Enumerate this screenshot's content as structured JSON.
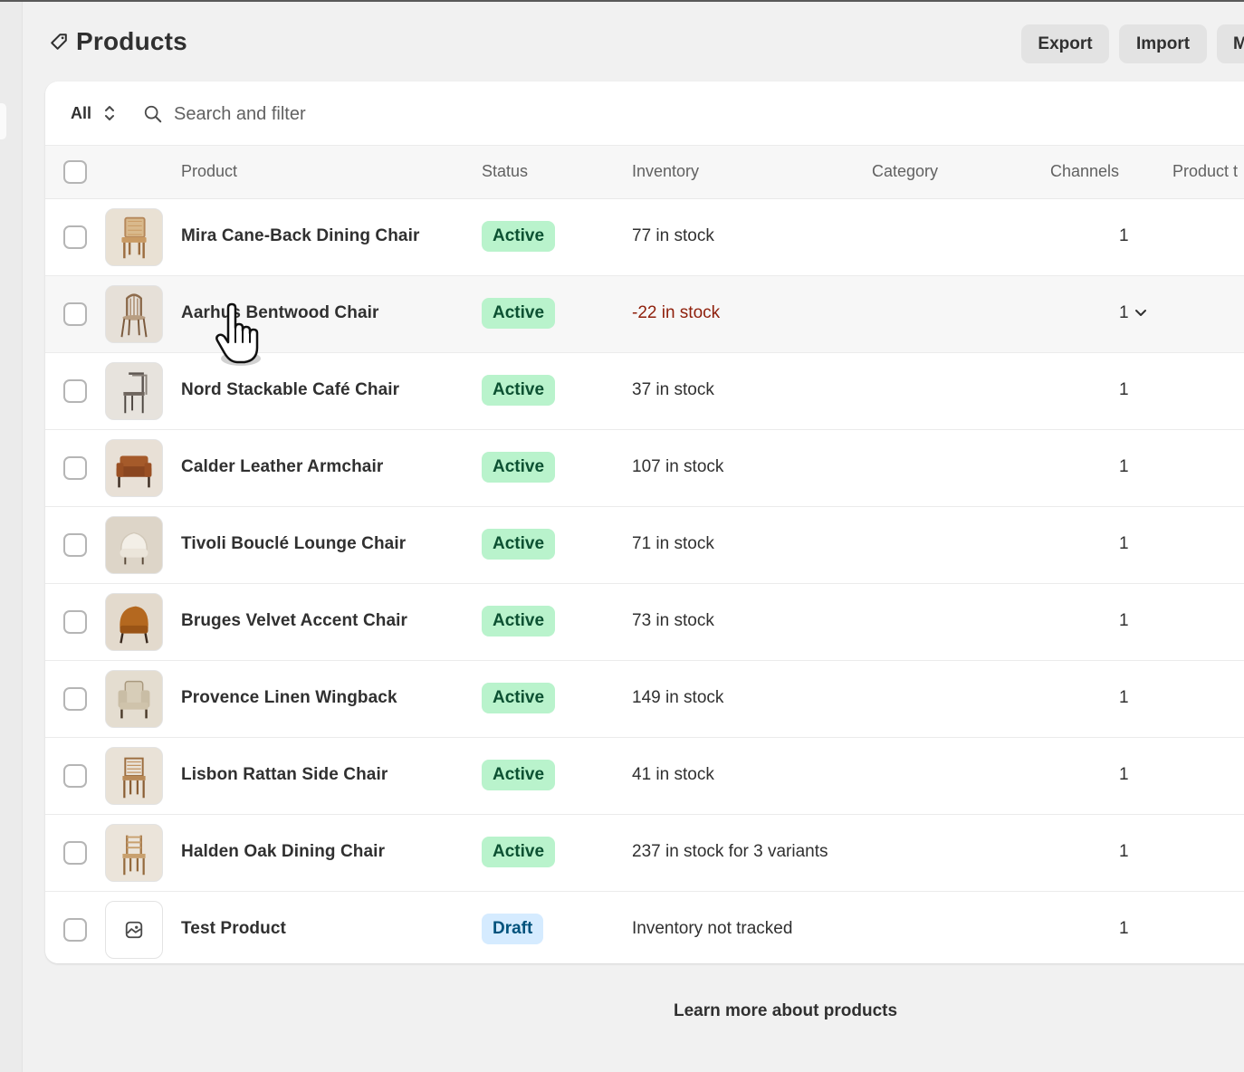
{
  "page": {
    "title": "Products",
    "title_icon": "tag-icon",
    "actions": [
      {
        "label": "Export"
      },
      {
        "label": "Import"
      },
      {
        "label": "M"
      }
    ]
  },
  "filters": {
    "view_label": "All",
    "search_placeholder": "Search and filter"
  },
  "table": {
    "columns": [
      "Product",
      "Status",
      "Inventory",
      "Category",
      "Channels",
      "Product t"
    ],
    "rows": [
      {
        "name": "Mira Cane-Back Dining Chair",
        "status": "Active",
        "inventory": "77 in stock",
        "category": "",
        "channels": "1",
        "thumb_color": "#c99a63"
      },
      {
        "name": "Aarhus Bentwood Chair",
        "status": "Active",
        "inventory": "-22 in stock",
        "category": "",
        "channels": "1",
        "thumb_color": "#b89e82"
      },
      {
        "name": "Nord Stackable Café Chair",
        "status": "Active",
        "inventory": "37 in stock",
        "category": "",
        "channels": "1",
        "thumb_color": "#9d8f82"
      },
      {
        "name": "Calder Leather Armchair",
        "status": "Active",
        "inventory": "107 in stock",
        "category": "",
        "channels": "1",
        "thumb_color": "#a55a2a"
      },
      {
        "name": "Tivoli Bouclé Lounge Chair",
        "status": "Active",
        "inventory": "71 in stock",
        "category": "",
        "channels": "1",
        "thumb_color": "#ece6da"
      },
      {
        "name": "Bruges Velvet Accent Chair",
        "status": "Active",
        "inventory": "73 in stock",
        "category": "",
        "channels": "1",
        "thumb_color": "#b4681f"
      },
      {
        "name": "Provence Linen Wingback",
        "status": "Active",
        "inventory": "149 in stock",
        "category": "",
        "channels": "1",
        "thumb_color": "#d7cdb8"
      },
      {
        "name": "Lisbon Rattan Side Chair",
        "status": "Active",
        "inventory": "41 in stock",
        "category": "",
        "channels": "1",
        "thumb_color": "#b88a58"
      },
      {
        "name": "Halden Oak Dining Chair",
        "status": "Active",
        "inventory": "237 in stock for 3 variants",
        "category": "",
        "channels": "1",
        "thumb_color": "#c8a06e"
      },
      {
        "name": "Test Product",
        "status": "Draft",
        "inventory": "Inventory not tracked",
        "category": "",
        "channels": "1",
        "thumb_color": "#ffffff"
      }
    ]
  },
  "footer": {
    "learn_more": "Learn more about products"
  },
  "colors": {
    "background": "#f1f1f1",
    "active_badge_bg": "#b9f3cc",
    "active_badge_text": "#0c5132",
    "draft_badge_bg": "#d5ebff",
    "draft_badge_text": "#00527c",
    "negative_stock": "#8e1f0b"
  }
}
